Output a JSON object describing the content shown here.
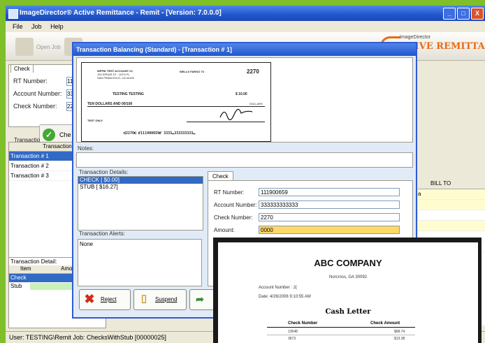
{
  "window": {
    "title": "ImageDirector® Active Remittance - Remit - [Version: 7.0.0.0]",
    "controls": [
      "_",
      "□",
      "X"
    ]
  },
  "menu": [
    "File",
    "Job",
    "Help"
  ],
  "toolbar": {
    "dimmed_label": "Open Job"
  },
  "logo": {
    "small": "ImageDirector",
    "big": "TIVE REMITTANCE"
  },
  "left_check_panel": {
    "tab": "Check",
    "rt_label": "RT Number:",
    "rt_value": "11",
    "account_label": "Account Number:",
    "account_value": "33",
    "check_label": "Check Number:",
    "check_value": "22"
  },
  "check_button": {
    "label": "Che"
  },
  "transactions": {
    "section_label": "Transactio",
    "column": "Transaction",
    "rows": [
      "Transaction # 1",
      "Transaction # 2",
      "Transaction # 3"
    ]
  },
  "transaction_detail": {
    "label": "Transaction Detail:",
    "columns": [
      "Item",
      "Amou"
    ],
    "rows": [
      "Check",
      "Stub"
    ]
  },
  "status_bar": "User: TESTING\\Remit  Job: ChecksWithStub [00000025]",
  "right_grid": {
    "header": "BILL TO",
    "partial_char": "a"
  },
  "dialog": {
    "title": "Transaction Balancing (Standard) - [Transaction # 1]",
    "check_image": {
      "payer": "WPFID TEST ACCOUNT #2",
      "payer_addr1": "100 SPEAR ST - 10TH FL",
      "payer_addr2": "SAN FRANCISCO, CA 94105",
      "bank": "WELLS FARGO 73",
      "number": "2270",
      "pay_to": "TESTING TESTING",
      "amount": "$ 10.00",
      "words": "TEN DOLLARS AND 00/100",
      "dollars": "DOLLARS",
      "memo": "TEST ONLY",
      "micr": "⑆227O⑆ ⑈111900659⑈ 3333⑉333333333⑉"
    },
    "notes_label": "Notes:",
    "transaction_details_label": "Transaction Details:",
    "transaction_details": [
      "CHECK [ $0.00]",
      "STUB [ $16.27]"
    ],
    "alerts_label": "Transaction Alerts:",
    "alerts_value": "None",
    "check_tab": "Check",
    "fields": {
      "rt_label": "RT Number:",
      "rt_value": "111900659",
      "account_label": "Account Number:",
      "account_value": "333333333333",
      "check_label": "Check Number:",
      "check_value": "2270",
      "amount_label": "Amount:",
      "amount_value": "0000"
    },
    "buttons": {
      "reject": "Reject",
      "suspend": "Suspend"
    }
  },
  "report": {
    "company": "ABC COMPANY",
    "address": "Norcross, GA 30092",
    "account_line": "Account Number :   2(",
    "date_line": "Date:   4/26/2006 9:10:55 AM",
    "title": "Cash Letter",
    "columns": [
      "Check Number",
      "Check Amount"
    ],
    "rows": [
      [
        "13548",
        "$68.74"
      ],
      [
        "3673",
        "$13.38"
      ]
    ]
  },
  "colors": {
    "frame_green": "#7fbf2a",
    "titlebar_blue": "#2156cc",
    "selection_blue": "#316ac5",
    "amount_highlight": "#ffd966",
    "logo_orange": "#e86b12"
  }
}
